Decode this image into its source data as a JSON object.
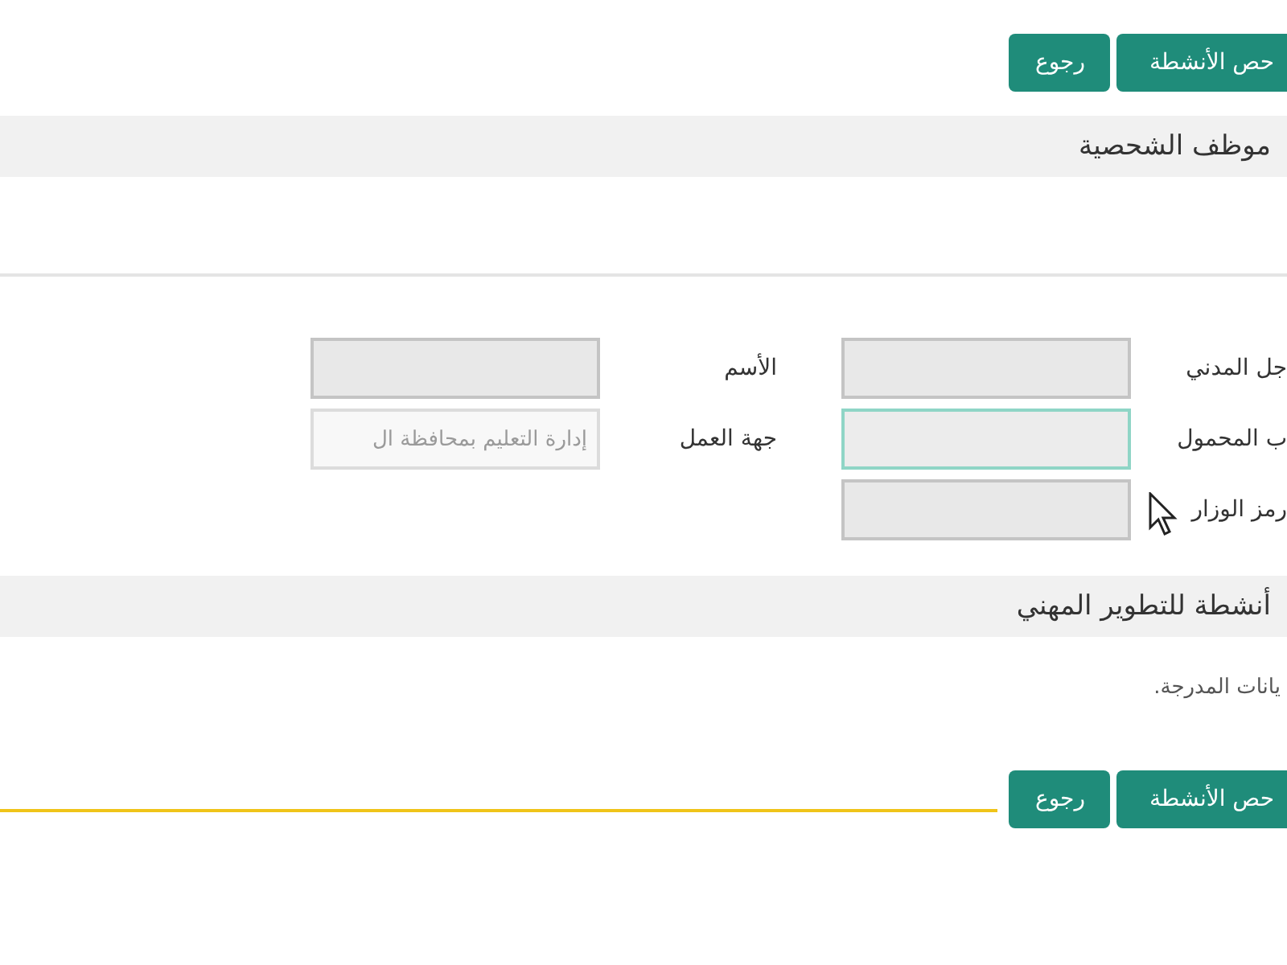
{
  "top_buttons": [
    {
      "label": "حص الأنشطة"
    },
    {
      "label": "رجوع"
    }
  ],
  "personal_section": {
    "title": "موظف الشحصية"
  },
  "form_columns": [
    [
      {
        "label": "جل المدني",
        "focused": false,
        "disabled": false
      },
      {
        "label": "ب المحمول",
        "focused": true,
        "disabled": false
      },
      {
        "label": "رمز الوزار",
        "focused": false,
        "disabled": false
      }
    ],
    [
      {
        "label": "الأسم",
        "focused": false,
        "disabled": false
      },
      {
        "label": "جهة العمل",
        "value": "إدارة التعليم بمحافظة ال",
        "focused": false,
        "disabled": true
      }
    ]
  ],
  "activities_section": {
    "title": "أنشطة للتطوير المهني",
    "note": "يانات المدرجة."
  },
  "bottom_buttons": [
    {
      "label": "حص الأنشطة"
    },
    {
      "label": "رجوع"
    }
  ]
}
